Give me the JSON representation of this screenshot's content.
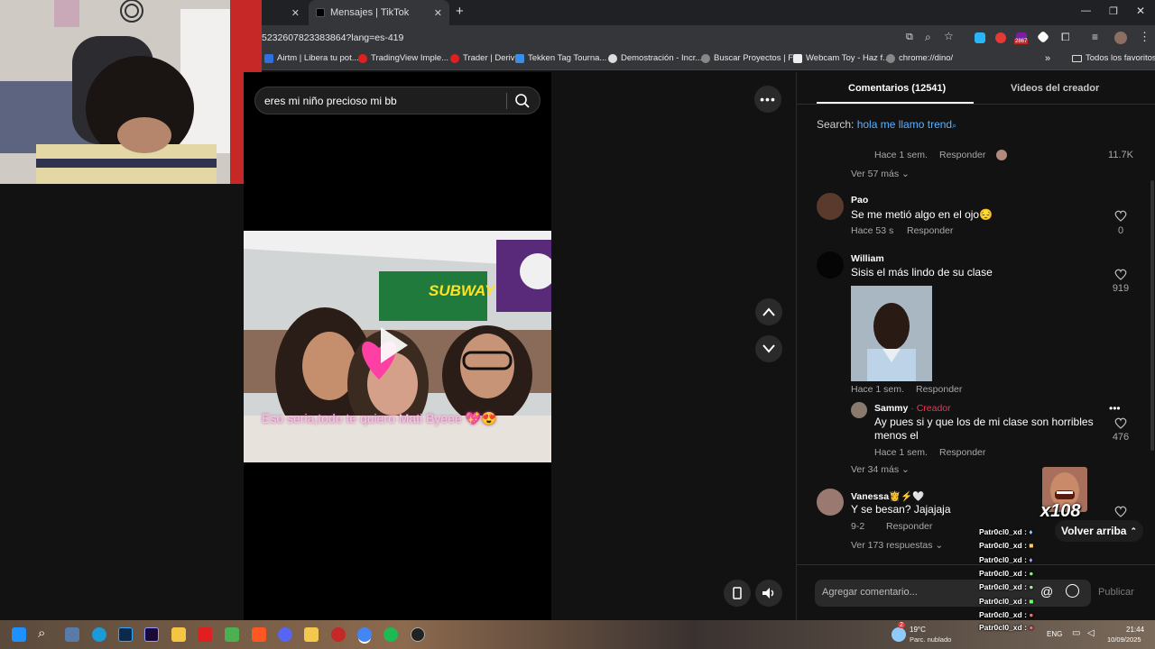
{
  "browser": {
    "tabs": [
      {
        "title": ""
      },
      {
        "title": "Mensajes | TikTok"
      }
    ],
    "new_tab_label": "+",
    "url": "5232607823383864?lang=es-419",
    "bookmarks": [
      {
        "label": "Airtm | Libera tu pot...",
        "color": "#2f6fe0"
      },
      {
        "label": "TradingView Imple...",
        "color": "#e02020"
      },
      {
        "label": "Trader | Deriv",
        "color": "#e02020"
      },
      {
        "label": "Tekken Tag Tourna...",
        "color": "#3a8ee6"
      },
      {
        "label": "Demostración - Incr...",
        "color": "#dddddd"
      },
      {
        "label": "Buscar Proyectos | F...",
        "color": "#888888"
      },
      {
        "label": "Webcam Toy - Haz f...",
        "color": "#eeeeee"
      },
      {
        "label": "chrome://dino/",
        "color": "#888888"
      }
    ],
    "more_bookmarks": "»",
    "all_favorites": "Todos los favoritos",
    "extension_badge": "2867"
  },
  "video": {
    "search_value": "eres mi niño precioso mi bb",
    "sign_text": "SUBWAY",
    "caption": "Eso seria,todo te quiero Mati Byeee 💖😍",
    "more_icon": "more-horizontal-icon",
    "accent": "#fe2c55"
  },
  "panel": {
    "tab_comments": "Comentarios (12541)",
    "tab_creator": "Videos del creador",
    "search_prefix": "Search:",
    "search_link": "hola me llamo trend",
    "top_meta_time": "Hace 1 sem.",
    "top_meta_reply": "Responder",
    "top_likes": "11.7K",
    "top_more": "Ver 57 más",
    "comments": [
      {
        "user": "Pao",
        "text": "Se me metió algo en el ojo😔",
        "time": "Hace 53 s",
        "reply": "Responder",
        "likes": "0"
      },
      {
        "user": "William",
        "text": "Sisis el más lindo de su clase",
        "time": "Hace 1 sem.",
        "reply": "Responder",
        "likes": "919"
      },
      {
        "user": "Sammy",
        "creator_tag": "· Creador",
        "text1": "Ay pues si y que los de mi clase son horribles",
        "text2": "menos el",
        "time": "Hace 1 sem.",
        "reply": "Responder",
        "likes": "476"
      },
      {
        "user": "Vanessa👸⚡🤍",
        "text": "Y se besan? Jajajaja",
        "time": "9-2",
        "reply": "Responder",
        "likes": ""
      }
    ],
    "more_34": "Ver 34 más",
    "more_173": "Ver 173 respuestas",
    "back_to_top": "Volver arriba",
    "add_comment_placeholder": "Agregar comentario...",
    "publish": "Publicar"
  },
  "overlay": {
    "multiplier": "x108",
    "chat": [
      "Patr0cl0_xd :",
      "Patr0cl0_xd :",
      "Patr0cl0_xd :",
      "Patr0cl0_xd :",
      "Patr0cl0_xd :",
      "Patr0cl0_xd :",
      "Patr0cl0_xd :",
      "Patr0cl0_xd :"
    ]
  },
  "taskbar": {
    "weather_badge": "2",
    "weather_temp": "19°C",
    "weather_desc": "Parc. nublado",
    "lang": "ENG",
    "time": "21:44",
    "date": "10/09/2025"
  }
}
